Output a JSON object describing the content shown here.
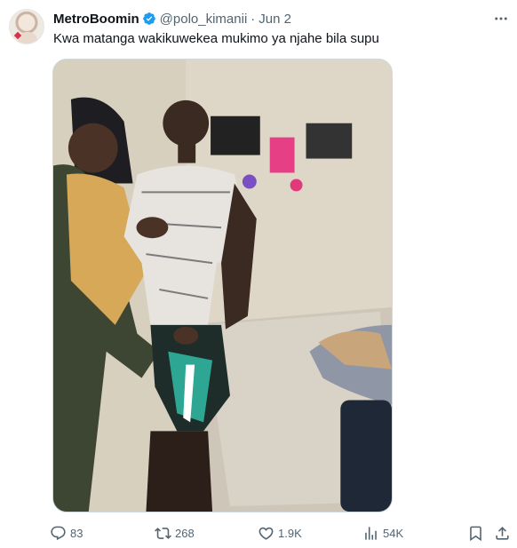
{
  "tweet": {
    "author_name": "MetroBoomin",
    "handle": "@polo_kimanii",
    "separator": "·",
    "date": "Jun 2",
    "text": "Kwa matanga wakikuwekea mukimo ya njahe bila supu",
    "verified_color": "#1d9bf0"
  },
  "actions": {
    "replies": "83",
    "retweets": "268",
    "likes": "1.9K",
    "views": "54K"
  },
  "icons": {
    "more": "more-horizontal-icon",
    "reply": "reply-icon",
    "retweet": "retweet-icon",
    "like": "heart-icon",
    "views": "analytics-icon",
    "bookmark": "bookmark-icon",
    "share": "share-icon"
  }
}
